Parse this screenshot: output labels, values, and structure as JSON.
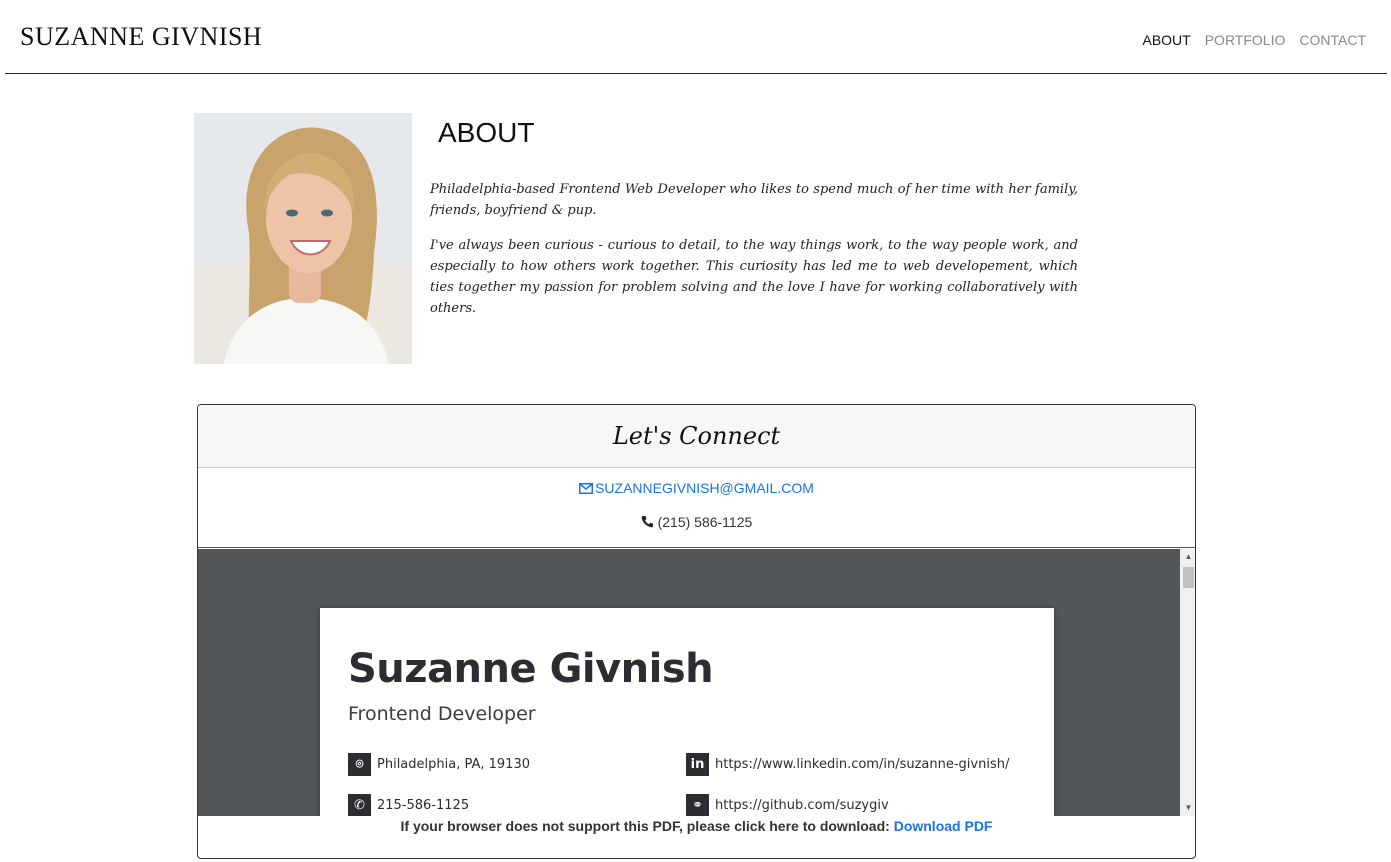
{
  "header": {
    "brand": "SUZANNE GIVNISH",
    "nav": [
      {
        "label": "ABOUT",
        "active": true
      },
      {
        "label": "PORTFOLIO",
        "active": false
      },
      {
        "label": "CONTACT",
        "active": false
      }
    ]
  },
  "about": {
    "title": "ABOUT",
    "paragraph_1": "Philadelphia-based Frontend Web Developer who likes to spend much of her time with her family, friends, boyfriend & pup.",
    "paragraph_2": "I've always been curious - curious to detail, to the way things work, to the way people work, and especially to how others work together. This curiosity has led me to web developement, which ties together my passion for problem solving and the love I have for working collaboratively with others."
  },
  "connect": {
    "title": "Let's Connect",
    "email": "SUZANNEGIVNISH@GMAIL.COM",
    "phone": "(215) 586-1125"
  },
  "pdf": {
    "name": "Suzanne Givnish",
    "role": "Frontend Developer",
    "location": "Philadelphia, PA, 19130",
    "phone": "215-586-1125",
    "linkedin": "https://www.linkedin.com/in/suzanne-givnish/",
    "github": "https://github.com/suzygiv",
    "fallback_text": "If your browser does not support this PDF, please click here to download:",
    "download_label": "Download PDF"
  },
  "colors": {
    "link": "#1a73e8",
    "pdf_background": "#525659"
  },
  "icons": {
    "email": "envelope-icon",
    "phone": "phone-icon",
    "pdf_location": "map-pin-icon",
    "pdf_phone": "phone-icon",
    "pdf_linkedin": "linkedin-icon",
    "pdf_github": "link-icon"
  }
}
